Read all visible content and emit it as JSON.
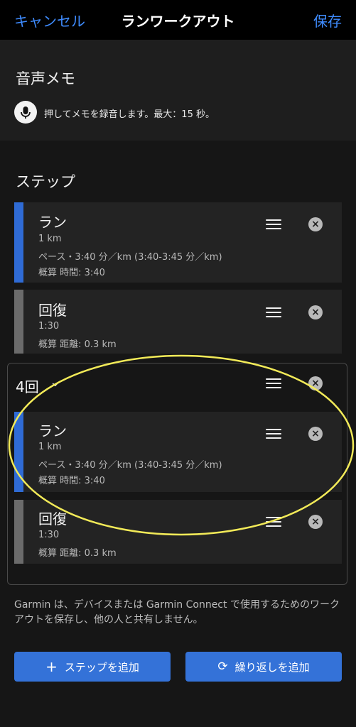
{
  "header": {
    "cancel": "キャンセル",
    "title": "ランワークアウト",
    "save": "保存"
  },
  "voice_memo": {
    "title": "音声メモ",
    "hint": "押してメモを録音します。最大：15 秒。"
  },
  "steps": {
    "title": "ステップ",
    "items": [
      {
        "title": "ラン",
        "distance": "1 km",
        "pace": "ペース・3:40 分／km (3:40-3:45 分／km)",
        "estimate": "概算 時間: 3:40"
      },
      {
        "title": "回復",
        "duration": "1:30",
        "estimate": "概算 距離: 0.3 km"
      }
    ],
    "repeat": {
      "label": "4回",
      "items": [
        {
          "title": "ラン",
          "distance": "1 km",
          "pace": "ペース・3:40 分／km (3:40-3:45 分／km)",
          "estimate": "概算 時間: 3:40"
        },
        {
          "title": "回復",
          "duration": "1:30",
          "estimate": "概算 距離: 0.3 km"
        }
      ]
    }
  },
  "footer_note": "Garmin は、デバイスまたは Garmin Connect で使用するためのワークアウトを保存し、他の人と共有しません。",
  "buttons": {
    "add_step": "ステップを追加",
    "add_repeat": "繰り返しを追加"
  },
  "colors": {
    "accent": "#3f8cff",
    "button": "#3472d8",
    "run_bar": "#2f6bd5",
    "recover_bar": "#6b6b6b",
    "highlight": "#f2ea58"
  }
}
